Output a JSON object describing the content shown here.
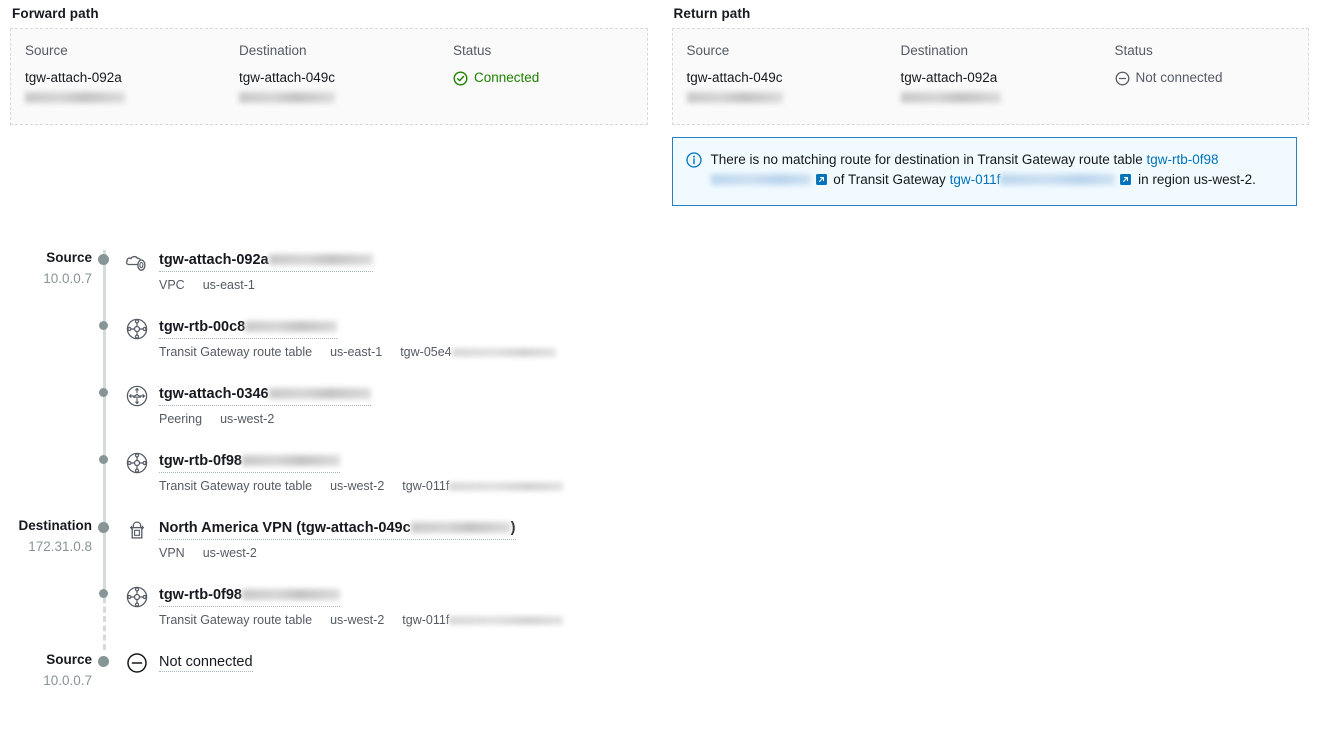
{
  "forward_panel": {
    "title": "Forward path",
    "headers": {
      "source": "Source",
      "destination": "Destination",
      "status": "Status"
    },
    "source": "tgw-attach-092a",
    "destination": "tgw-attach-049c",
    "status": "Connected",
    "status_state": "connected",
    "status_color": "#1d8102"
  },
  "return_panel": {
    "title": "Return path",
    "headers": {
      "source": "Source",
      "destination": "Destination",
      "status": "Status"
    },
    "source": "tgw-attach-049c",
    "destination": "tgw-attach-092a",
    "status": "Not connected",
    "status_state": "not-connected",
    "status_color": "#545b64"
  },
  "alert": {
    "icon": "info-icon",
    "text_1": "There is no matching route for destination in Transit Gateway route table ",
    "link_1": "tgw-rtb-0f98",
    "text_2": " of Transit Gateway ",
    "link_2": "tgw-011f",
    "text_3": " in region us-west-2.",
    "border_color": "#2a7fc0",
    "background_color": "#f1faff"
  },
  "timeline": {
    "endpoints": {
      "source_label": "Source",
      "source_ip": "10.0.0.7",
      "destination_label": "Destination",
      "destination_ip": "172.31.0.8"
    },
    "nodes": [
      {
        "icon": "vpc-cloud-icon",
        "title": "tgw-attach-092a",
        "title_suffix": "",
        "meta": [
          "VPC",
          "us-east-1"
        ],
        "meta_extra": "",
        "endpoint": "source",
        "endpoint_ip": "10.0.0.7"
      },
      {
        "icon": "route-table-icon",
        "title": "tgw-rtb-00c8",
        "title_suffix": "",
        "meta": [
          "Transit Gateway route table",
          "us-east-1"
        ],
        "meta_extra": "tgw-05e4",
        "endpoint": "",
        "endpoint_ip": ""
      },
      {
        "icon": "peering-icon",
        "title": "tgw-attach-0346",
        "title_suffix": "",
        "meta": [
          "Peering",
          "us-west-2"
        ],
        "meta_extra": "",
        "endpoint": "",
        "endpoint_ip": ""
      },
      {
        "icon": "route-table-icon",
        "title": "tgw-rtb-0f98",
        "title_suffix": "",
        "meta": [
          "Transit Gateway route table",
          "us-west-2"
        ],
        "meta_extra": "tgw-011f",
        "endpoint": "",
        "endpoint_ip": ""
      },
      {
        "icon": "vpn-lock-icon",
        "title": "North America VPN (tgw-attach-049c",
        "title_suffix": ")",
        "meta": [
          "VPN",
          "us-west-2"
        ],
        "meta_extra": "",
        "endpoint": "destination",
        "endpoint_ip": "172.31.0.8"
      },
      {
        "icon": "route-table-icon",
        "title": "tgw-rtb-0f98",
        "title_suffix": "",
        "meta": [
          "Transit Gateway route table",
          "us-west-2"
        ],
        "meta_extra": "tgw-011f",
        "endpoint": "",
        "endpoint_ip": ""
      }
    ],
    "terminal": {
      "icon": "minus-circle-icon",
      "label": "Not connected",
      "endpoint": "Source",
      "endpoint_ip": "10.0.0.7"
    }
  }
}
